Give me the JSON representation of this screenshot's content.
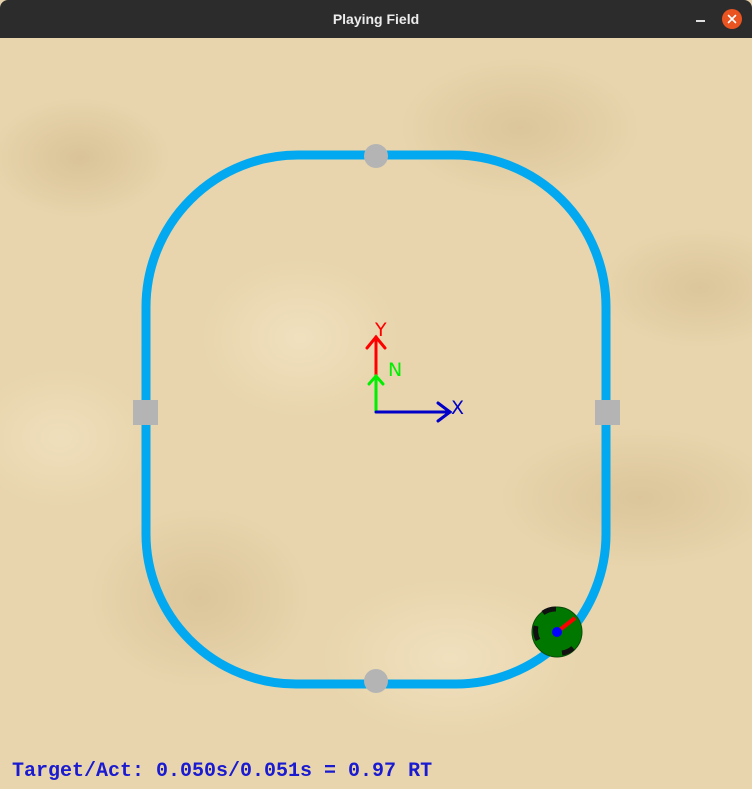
{
  "window": {
    "title": "Playing Field"
  },
  "axes": {
    "x_label": "X",
    "y_label": "Y",
    "n_label": "N"
  },
  "status": {
    "text": "Target/Act: 0.050s/0.051s = 0.97 RT"
  },
  "colors": {
    "track": "#03a9f0",
    "x_axis": "#0000c8",
    "y_axis": "#ff0000",
    "n_axis": "#00ee00",
    "marker": "#b4b4b4",
    "robot_body": "#007800",
    "robot_center": "#0000ff",
    "robot_heading": "#ff0000",
    "status_text": "#1a1ad0"
  },
  "icons": {
    "close": "close-icon",
    "minimize": "minimize-icon"
  }
}
